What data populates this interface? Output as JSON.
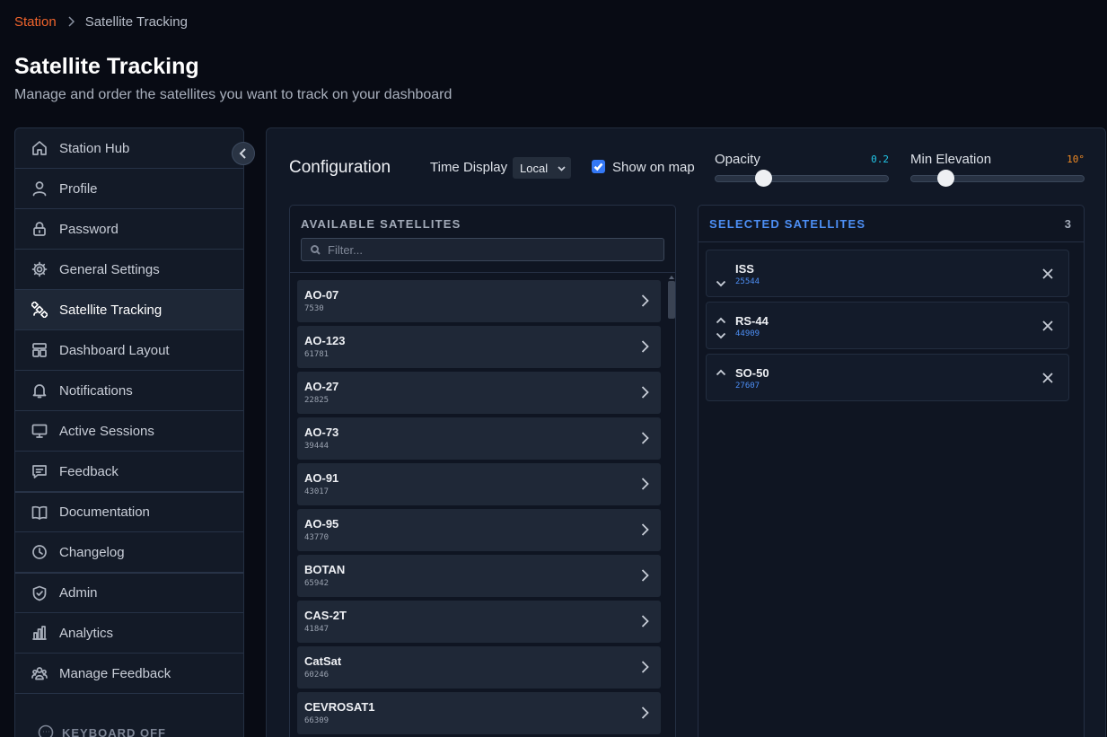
{
  "breadcrumb": {
    "root": "Station",
    "current": "Satellite Tracking"
  },
  "page": {
    "title": "Satellite Tracking",
    "subtitle": "Manage and order the satellites you want to track on your dashboard"
  },
  "sidebar": {
    "items": [
      {
        "label": "Station Hub",
        "icon": "home-icon"
      },
      {
        "label": "Profile",
        "icon": "user-icon"
      },
      {
        "label": "Password",
        "icon": "lock-icon"
      },
      {
        "label": "General Settings",
        "icon": "gear-icon"
      },
      {
        "label": "Satellite Tracking",
        "icon": "satellite-icon",
        "active": true
      },
      {
        "label": "Dashboard Layout",
        "icon": "layout-icon"
      },
      {
        "label": "Notifications",
        "icon": "bell-icon"
      },
      {
        "label": "Active Sessions",
        "icon": "monitor-icon"
      },
      {
        "label": "Feedback",
        "icon": "message-icon"
      },
      {
        "label": "Documentation",
        "icon": "book-icon"
      },
      {
        "label": "Changelog",
        "icon": "clock-icon"
      },
      {
        "label": "Admin",
        "icon": "shield-icon"
      },
      {
        "label": "Analytics",
        "icon": "bar-chart-icon"
      },
      {
        "label": "Manage Feedback",
        "icon": "users-icon"
      }
    ],
    "keyboard_label": "KEYBOARD OFF"
  },
  "config": {
    "title": "Configuration",
    "time_display_label": "Time Display",
    "time_display_value": "Local",
    "show_on_map_label": "Show on map",
    "show_on_map_checked": true,
    "opacity_label": "Opacity",
    "opacity_value": "0.2",
    "opacity_fraction": 0.2,
    "min_elevation_label": "Min Elevation",
    "min_elevation_value": "10°",
    "min_elevation_fraction": 0.15
  },
  "available": {
    "header": "AVAILABLE SATELLITES",
    "filter_placeholder": "Filter...",
    "satellites": [
      {
        "name": "AO-07",
        "id": "7530"
      },
      {
        "name": "AO-123",
        "id": "61781"
      },
      {
        "name": "AO-27",
        "id": "22825"
      },
      {
        "name": "AO-73",
        "id": "39444"
      },
      {
        "name": "AO-91",
        "id": "43017"
      },
      {
        "name": "AO-95",
        "id": "43770"
      },
      {
        "name": "BOTAN",
        "id": "65942"
      },
      {
        "name": "CAS-2T",
        "id": "41847"
      },
      {
        "name": "CatSat",
        "id": "60246"
      },
      {
        "name": "CEVROSAT1",
        "id": "66309"
      }
    ]
  },
  "selected": {
    "header": "SELECTED SATELLITES",
    "count": "3",
    "satellites": [
      {
        "name": "ISS",
        "id": "25544",
        "up": false,
        "down": true
      },
      {
        "name": "RS-44",
        "id": "44909",
        "up": true,
        "down": true
      },
      {
        "name": "SO-50",
        "id": "27607",
        "up": true,
        "down": false
      }
    ]
  },
  "colors": {
    "accent": "#f0642c",
    "link_blue": "#4d8ff5",
    "opacity_value": "#22c7e8",
    "elevation_value": "#f08a24"
  }
}
